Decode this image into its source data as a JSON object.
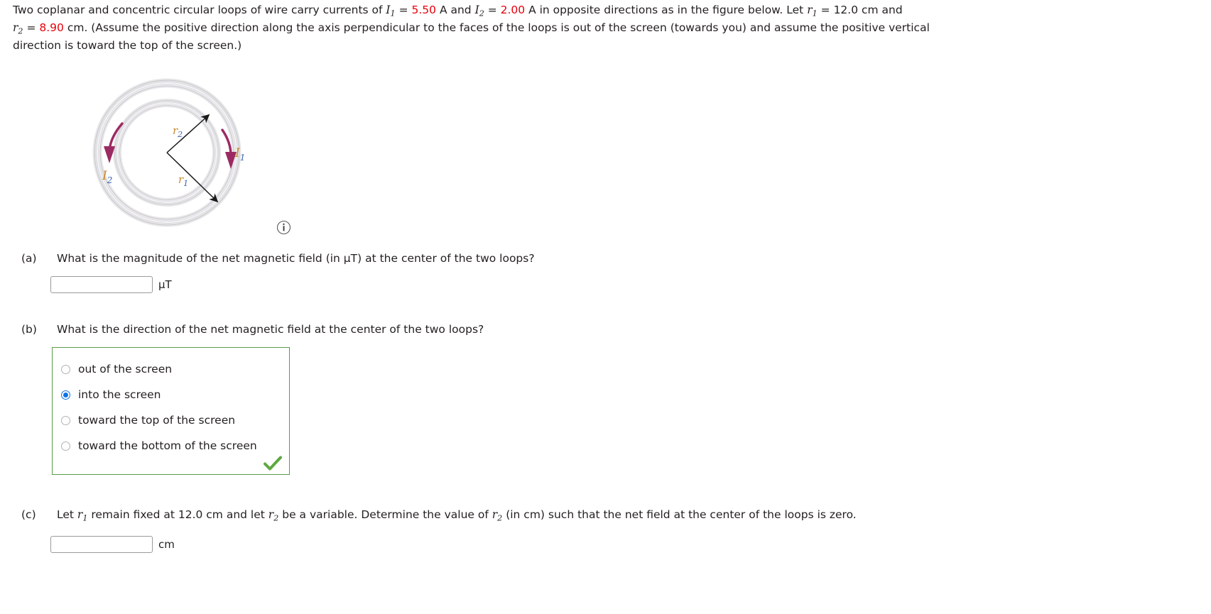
{
  "problem": {
    "line1_a": "Two coplanar and concentric circular loops of wire carry currents of ",
    "I1_sym": "I",
    "I1_sub": "1",
    "eq": " = ",
    "I1_val": "5.50",
    "line1_b": " A and ",
    "I2_sym": "I",
    "I2_sub": "2",
    "I2_val": "2.00",
    "line1_c": " A in opposite directions as in the figure below. Let ",
    "r1_sym": "r",
    "r1_sub": "1",
    "r1_val": "12.0 cm",
    "line1_d": " and",
    "r2_sym": "r",
    "r2_sub": "2",
    "r2_val": "8.90",
    "line2_a": " cm. (Assume the positive direction along the axis perpendicular to the faces of the loops is out of the screen (towards you) and assume the positive vertical",
    "line3": "direction is toward the top of the screen.)"
  },
  "figure": {
    "outer_current_label": "I",
    "outer_current_sub": "1",
    "inner_current_label": "I",
    "inner_current_sub": "2",
    "radius_outer_label": "r",
    "radius_outer_sub": "1",
    "radius_inner_label": "r",
    "radius_inner_sub": "2",
    "arrow_color": "#9c2a62",
    "ring_color": "#cdccd0",
    "label_color": "#c9892b",
    "subscript_color": "#3a63b0",
    "info_tooltip": "i"
  },
  "parts": {
    "a": {
      "label": "(a)",
      "question": "What is the magnitude of the net magnetic field (in µT) at the center of the two loops?",
      "input_value": "",
      "unit": "µT"
    },
    "b": {
      "label": "(b)",
      "question": "What is the direction of the net magnetic field at the center of the two loops?",
      "options": [
        {
          "text": "out of the screen",
          "selected": false
        },
        {
          "text": "into the screen",
          "selected": true
        },
        {
          "text": "toward the top of the screen",
          "selected": false
        },
        {
          "text": "toward the bottom of the screen",
          "selected": false
        }
      ],
      "correct_indicator": "check",
      "border_color": "#5b9b4a",
      "check_color": "#5da83f"
    },
    "c": {
      "label": "(c)",
      "q_part1": "Let ",
      "q_r1_sym": "r",
      "q_r1_sub": "1",
      "q_part2": " remain fixed at 12.0 cm and let ",
      "q_r2_sym": "r",
      "q_r2_sub": "2",
      "q_part3": " be a variable. Determine the value of ",
      "q_r2b_sym": "r",
      "q_r2b_sub": "2",
      "q_part4": " (in cm) such that the net field at the center of the loops is zero.",
      "input_value": "",
      "unit": "cm"
    }
  }
}
